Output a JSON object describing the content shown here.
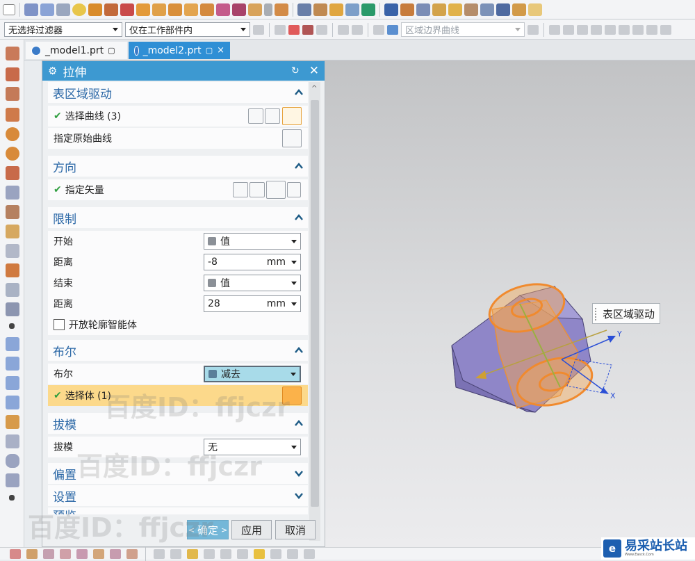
{
  "colors": {
    "title_bar": "#3d99d1",
    "tab_active": "#2f8fd5",
    "section_header_text": "#2a67a6",
    "check_green": "#2e9e3e",
    "highlight_row": "#fcd98b",
    "boolean_field": "#a8dbe9",
    "solid_body": "#8f86c8",
    "orange_ring": "#f39a3a"
  },
  "filter_bar": {
    "type_filter": "无选择过滤器",
    "scope_filter": "仅在工作部件内",
    "curve_rule": "区域边界曲线"
  },
  "tabs": [
    {
      "label": "_model1.prt"
    },
    {
      "label": "_model2.prt"
    }
  ],
  "dialog": {
    "title": "拉伸",
    "sections": {
      "surface_drive": {
        "title": "表区域驱动",
        "select_curve": "选择曲线 (3)",
        "specify_origin_curve": "指定原始曲线"
      },
      "direction": {
        "title": "方向",
        "specify_vector": "指定矢量"
      },
      "limits": {
        "title": "限制",
        "start_label": "开始",
        "start_value": "值",
        "start_distance_label": "距离",
        "start_distance": "-8",
        "start_unit": "mm",
        "end_label": "结束",
        "end_value": "值",
        "end_distance_label": "距离",
        "end_distance": "28",
        "end_unit": "mm",
        "open_profile_label": "开放轮廓智能体"
      },
      "boolean": {
        "title": "布尔",
        "label": "布尔",
        "value": "减去",
        "select_body": "选择体 (1)"
      },
      "draft": {
        "title": "拔模",
        "label": "拔模",
        "value": "无"
      },
      "offset": {
        "title": "偏置"
      },
      "settings": {
        "title": "设置"
      },
      "preview": {
        "title": "预览"
      }
    },
    "buttons": {
      "ok": "确定",
      "apply": "应用",
      "cancel": "取消"
    }
  },
  "viewport": {
    "callout_label": "表区域驱动",
    "axis_x": "X",
    "axis_y": "Y"
  },
  "watermarks": [
    "百度ID：ffjczr",
    "百度ID：ffjczr",
    "百度ID：ffjczr"
  ],
  "logo": {
    "mark": "e",
    "name": "易采站长站",
    "sub": "Www.Easck.Com"
  }
}
